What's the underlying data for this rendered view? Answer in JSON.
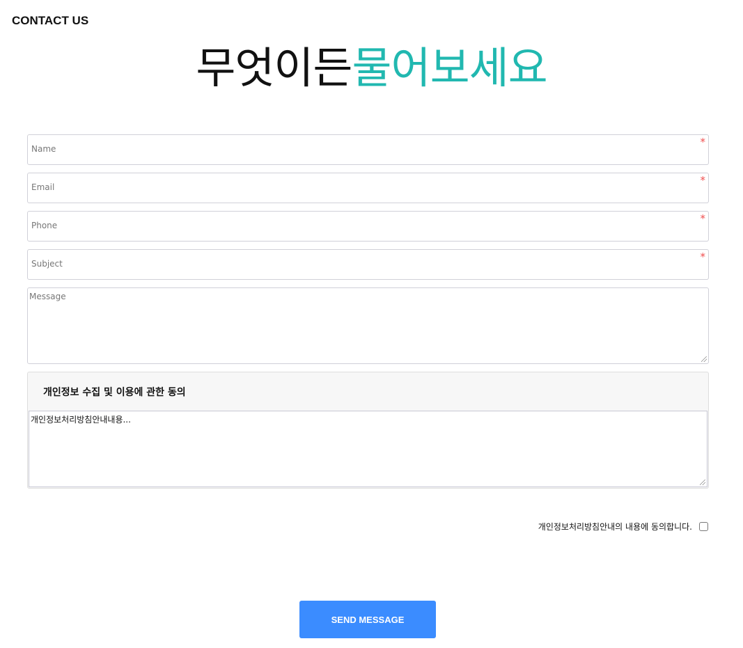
{
  "header": {
    "label": "CONTACT US",
    "headline_part1": "무엇이든",
    "headline_part2": "물어보세요",
    "accent_color": "#21b8b0"
  },
  "form": {
    "fields": [
      {
        "placeholder": "Name",
        "required_mark": "*"
      },
      {
        "placeholder": "Email",
        "required_mark": "*"
      },
      {
        "placeholder": "Phone",
        "required_mark": "*"
      },
      {
        "placeholder": "Subject",
        "required_mark": "*"
      }
    ],
    "message_placeholder": "Message",
    "consent": {
      "title": "개인정보 수집 및 이용에 관한 동의",
      "content": "개인정보처리방침안내내용...",
      "agree_label": "개인정보처리방침안내의 내용에 동의합니다.",
      "checked": false
    },
    "submit_label": "SEND MESSAGE",
    "button_color": "#3b8cff"
  }
}
